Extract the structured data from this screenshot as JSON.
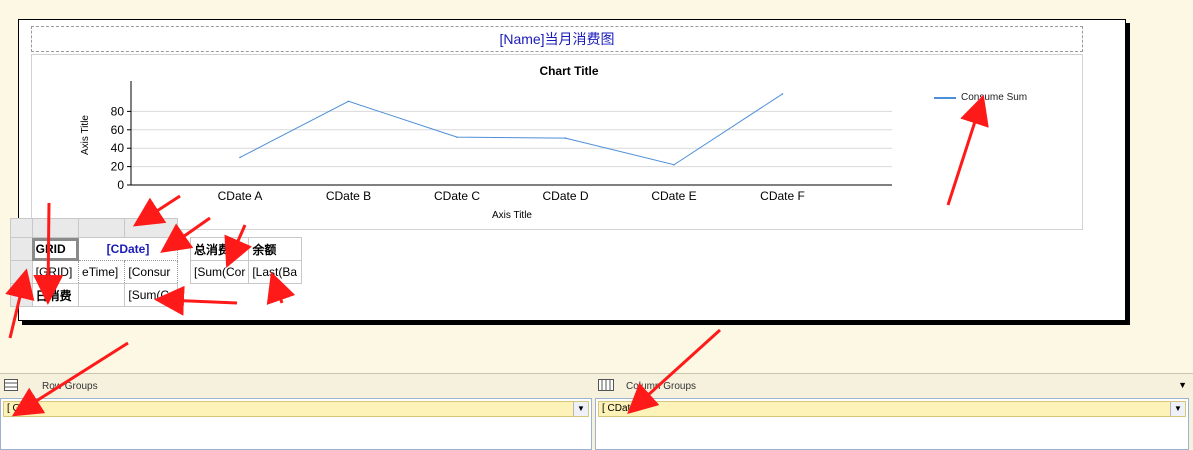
{
  "report": {
    "title": "[Name]当月消费图"
  },
  "chart_data": {
    "type": "line",
    "title": "Chart Title",
    "xlabel": "Axis Title",
    "ylabel": "Axis Title",
    "categories": [
      "CDate A",
      "CDate B",
      "CDate C",
      "CDate D",
      "CDate E",
      "CDate F"
    ],
    "series": [
      {
        "name": "Consume Sum",
        "values": [
          30,
          91,
          52,
          51,
          22,
          99
        ]
      }
    ],
    "yticks": [
      0,
      20,
      40,
      60,
      80
    ],
    "ylim": [
      0,
      100
    ],
    "grid": true,
    "legend": "right",
    "color": "#4d8ed8"
  },
  "tablix": {
    "header": {
      "grid": "GRID",
      "cdate": "[CDate]",
      "total": "总消费",
      "balance": "余额"
    },
    "detail": {
      "grid": "[GRID]",
      "time": "eTime]",
      "consume": "[Consur",
      "sum": "[Sum(Cor",
      "last": "[Last(Ba"
    },
    "footer": {
      "label": "日消费",
      "sum": "[Sum(C"
    }
  },
  "groups": {
    "row_title": "Row Groups",
    "row_item": "[ GRID",
    "col_title": "Column Groups",
    "col_item": "[ CDate"
  },
  "colors": {
    "line": "#4d8ed8",
    "arrow": "#ff1a1a",
    "group_fill": "#fdf2b7"
  }
}
